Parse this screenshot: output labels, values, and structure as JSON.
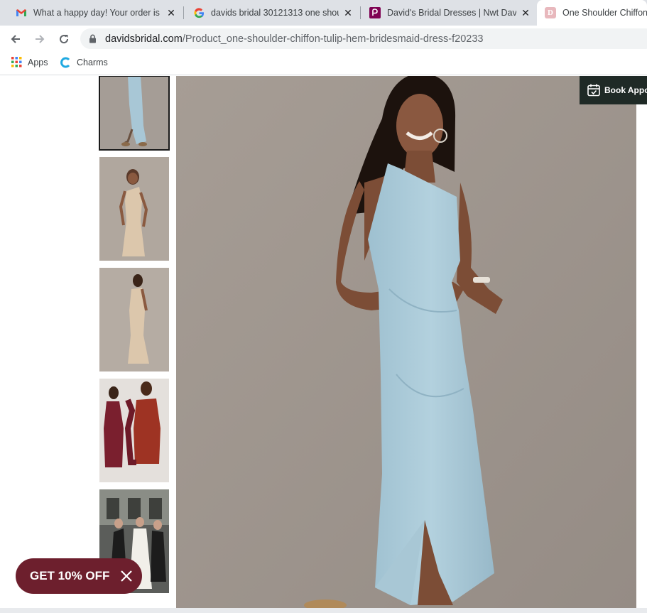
{
  "tabs": [
    {
      "title": "What a happy day! Your order is",
      "icon": "gmail-icon"
    },
    {
      "title": "davids bridal 30121313 one shou",
      "icon": "google-icon"
    },
    {
      "title": "David's Bridal Dresses | Nwt Davi",
      "icon": "poshmark-icon"
    },
    {
      "title": "One Shoulder Chiffon",
      "icon": "davids-bridal-icon"
    }
  ],
  "address": {
    "domain": "davidsbridal.com",
    "path": "/Product_one-shoulder-chiffon-tulip-hem-bridesmaid-dress-f20233"
  },
  "bookmarks": [
    {
      "label": "Apps",
      "icon": "apps-grid-icon"
    },
    {
      "label": "Charms",
      "icon": "charms-c-icon"
    }
  ],
  "page": {
    "book_label": "Book Appo",
    "promo_label": "GET 10% OFF",
    "thumbnails": [
      "blue-dress-front",
      "champagne-dress-front",
      "champagne-dress-back",
      "red-dress-group",
      "wedding-party-photo"
    ],
    "selected_thumbnail": 1
  },
  "colors": {
    "promo": "#6d1f2d",
    "book_button": "#1f2a26",
    "dress_blue": "#a9c9d8",
    "backdrop": "#9f968f"
  }
}
